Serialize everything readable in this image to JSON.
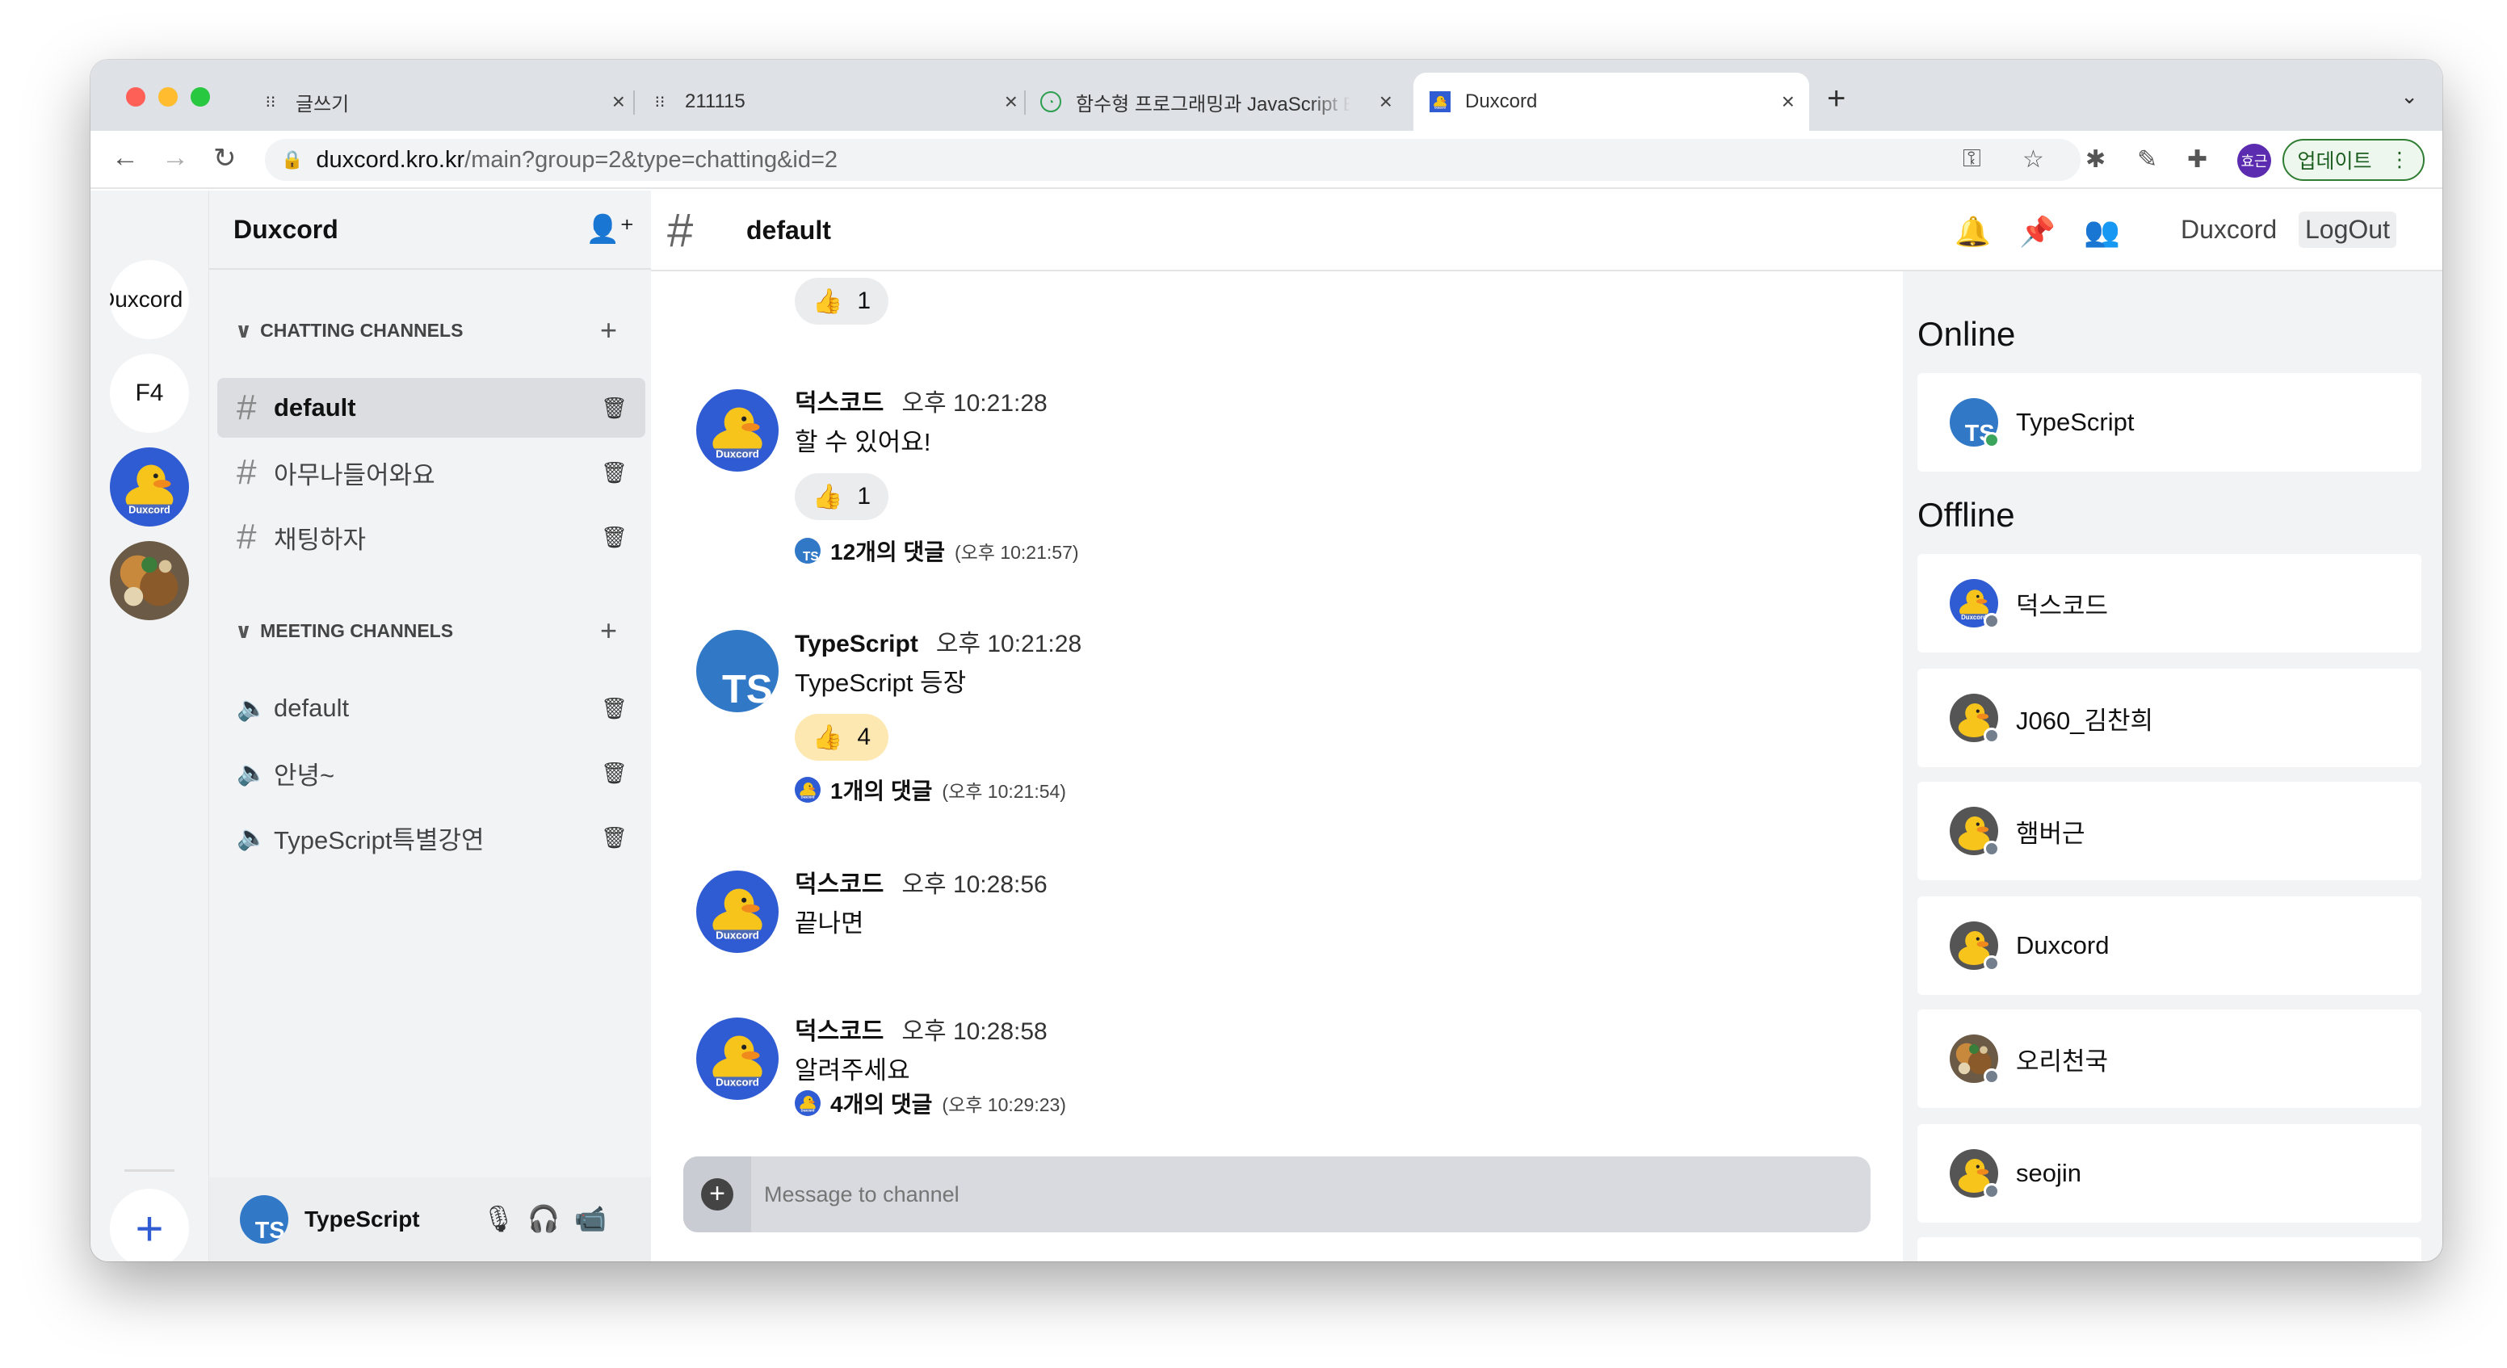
{
  "browser": {
    "tabs": [
      {
        "title": "글쓰기",
        "icon": "dots-icon"
      },
      {
        "title": "211115",
        "icon": "dots-icon"
      },
      {
        "title": "함수형 프로그래밍과 JavaScript ES",
        "icon": "lecture-icon"
      },
      {
        "title": "Duxcord",
        "icon": "duck-icon"
      }
    ],
    "url_host": "duxcord.kro.kr",
    "url_path": "/main?group=2&type=chatting&id=2",
    "profile_initials": "효근",
    "update_label": "업데이트"
  },
  "servers": [
    {
      "label": "Duxcord"
    },
    {
      "label": "F4"
    }
  ],
  "sidebar": {
    "title": "Duxcord",
    "chatting_header": "CHATTING CHANNELS",
    "meeting_header": "MEETING CHANNELS",
    "chatting_channels": [
      "default",
      "아무나들어와요",
      "채팅하자"
    ],
    "meeting_channels": [
      "default",
      "안녕~",
      "TypeScript특별강연"
    ],
    "user": {
      "name": "TypeScript",
      "avatar_text": "TS"
    }
  },
  "header": {
    "channel": "default",
    "links": [
      "Duxcord",
      "LogOut"
    ]
  },
  "messages": [
    {
      "reaction_count": "1"
    },
    {
      "author": "덕스코드",
      "time": "오후 10:21:28",
      "text": "할 수 있어요!",
      "reaction_count": "1",
      "thread": "12개의 댓글",
      "thread_time": "(오후 10:21:57)"
    },
    {
      "author": "TypeScript",
      "time": "오후 10:21:28",
      "text": "TypeScript 등장",
      "reaction_count": "4",
      "thread": "1개의 댓글",
      "thread_time": "(오후 10:21:54)"
    },
    {
      "author": "덕스코드",
      "time": "오후 10:28:56",
      "text": "끝나면"
    },
    {
      "author": "덕스코드",
      "time": "오후 10:28:58",
      "text": "알려주세요",
      "thread": "4개의 댓글",
      "thread_time": "(오후 10:29:23)"
    }
  ],
  "composer": {
    "placeholder": "Message to channel"
  },
  "members": {
    "online_label": "Online",
    "offline_label": "Offline",
    "online": [
      {
        "name": "TypeScript",
        "avatar": "ts"
      }
    ],
    "offline": [
      {
        "name": "덕스코드",
        "avatar": "duck-blue"
      },
      {
        "name": "J060_김찬희",
        "avatar": "duck"
      },
      {
        "name": "햄버근",
        "avatar": "duck"
      },
      {
        "name": "Duxcord",
        "avatar": "duck"
      },
      {
        "name": "오리천국",
        "avatar": "food"
      },
      {
        "name": "seojin",
        "avatar": "duck"
      }
    ]
  },
  "colors": {
    "accent": "#2f5bd3",
    "ts_blue": "#3178c6",
    "online": "#3ba55d",
    "offline": "#747f8d"
  }
}
